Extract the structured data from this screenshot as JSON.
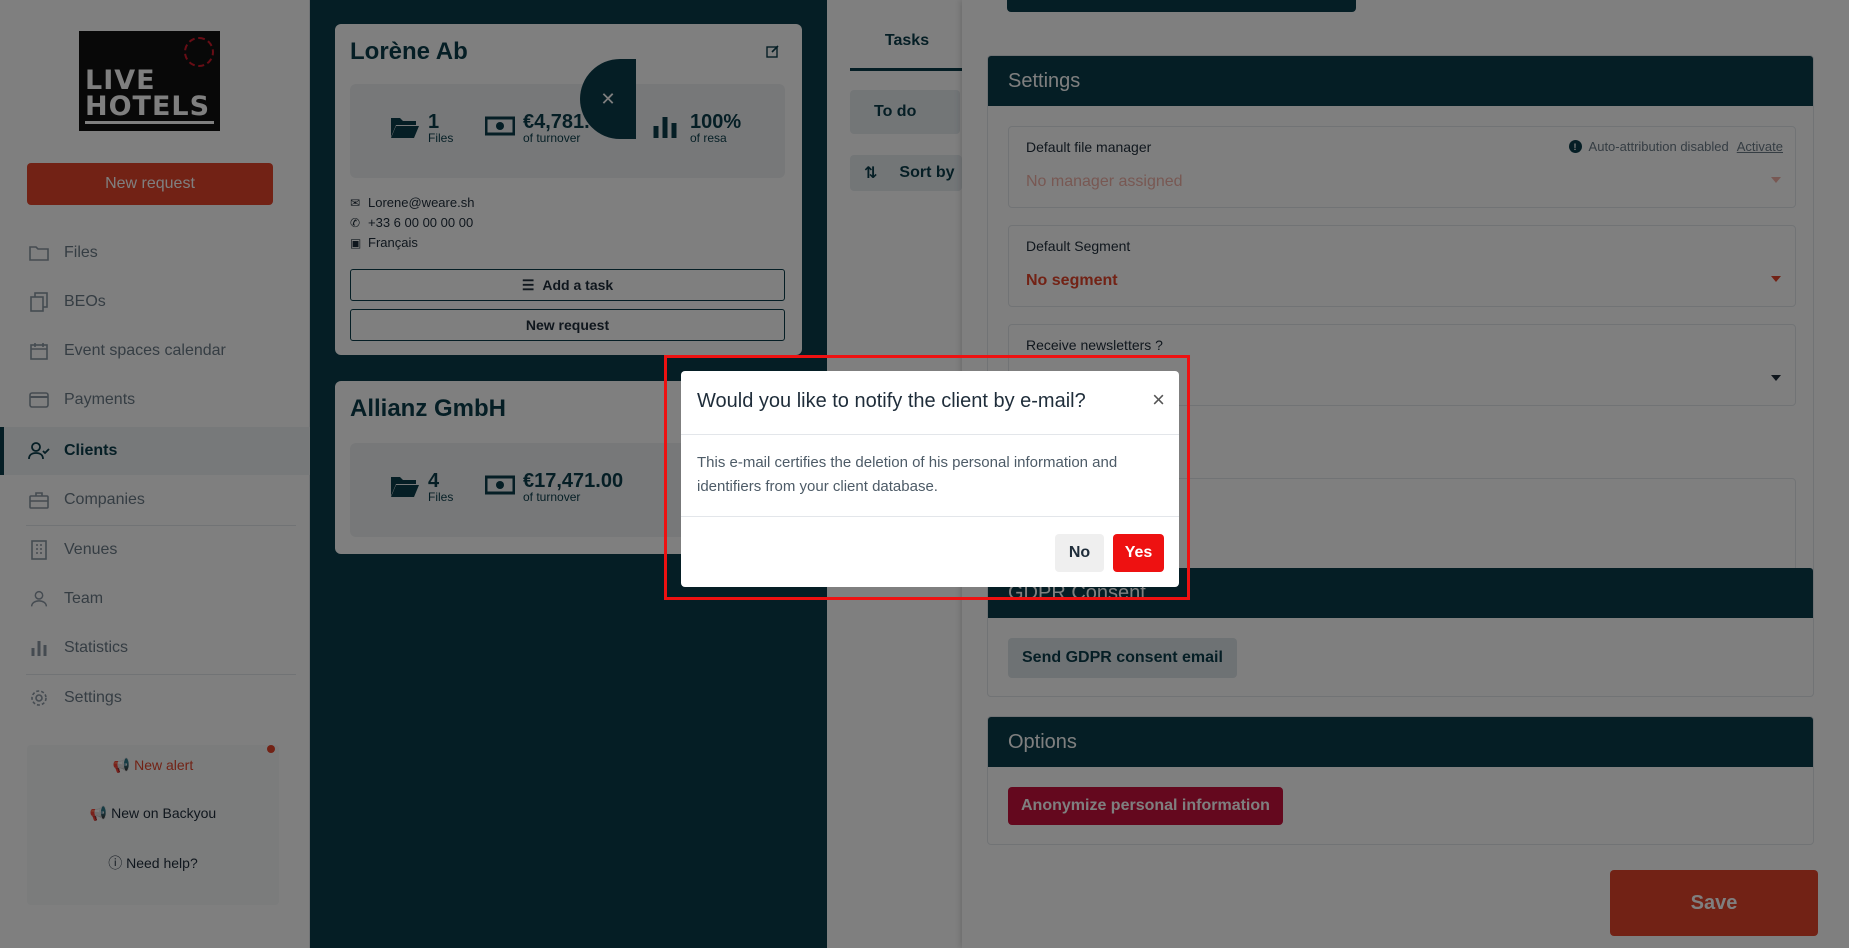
{
  "sidebar": {
    "logo_line1": "LIVE",
    "logo_line2": "HOTELS",
    "new_request_label": "New request",
    "items": [
      {
        "label": "Files",
        "icon": "folder-icon"
      },
      {
        "label": "BEOs",
        "icon": "copy-icon"
      },
      {
        "label": "Event spaces calendar",
        "icon": "calendar-icon"
      },
      {
        "label": "Payments",
        "icon": "credit-card-icon"
      },
      {
        "label": "Clients",
        "icon": "users-icon",
        "active": true
      },
      {
        "label": "Companies",
        "icon": "briefcase-icon"
      },
      {
        "label": "Venues",
        "icon": "building-icon"
      },
      {
        "label": "Team",
        "icon": "team-icon"
      },
      {
        "label": "Statistics",
        "icon": "bar-chart-icon"
      },
      {
        "label": "Settings",
        "icon": "gear-icon"
      }
    ],
    "new_alert": "New alert",
    "new_on_backyou": "New on Backyou",
    "need_help": "Need help?"
  },
  "clients": [
    {
      "name": "Lorène Ab",
      "files": "1",
      "files_label": "Files",
      "turnover": "€4,781.00",
      "turnover_label": "of turnover",
      "resa": "100%",
      "resa_label": "of resa",
      "email": "Lorene@weare.sh",
      "phone": "+33 6 00 00 00 00",
      "language": "Français",
      "add_task_label": "Add a task",
      "new_request_label": "New request"
    },
    {
      "name": "Allianz GmbH",
      "files": "4",
      "files_label": "Files",
      "turnover": "€17,471.00",
      "turnover_label": "of turnover"
    }
  ],
  "tasks": {
    "tab_label": "Tasks",
    "todo_label": "To do",
    "sort_label": "Sort by"
  },
  "drawer": {
    "settings_title": "Settings",
    "file_manager_label": "Default file manager",
    "file_manager_value": "No manager assigned",
    "auto_attr_text": "Auto-attribution disabled",
    "activate_link": "Activate",
    "segment_label": "Default Segment",
    "segment_value": "No segment",
    "newsletter_label": "Receive newsletters ?",
    "gdpr_title": "GDPR Consent",
    "gdpr_button": "Send GDPR consent email",
    "options_title": "Options",
    "anonymize_button": "Anonymize personal information",
    "save_label": "Save"
  },
  "modal": {
    "title": "Would you like to notify the client by e-mail?",
    "body": "This e-mail certifies the deletion of his personal information and identifiers from your client database.",
    "no_label": "No",
    "yes_label": "Yes"
  },
  "colors": {
    "primary_teal": "#0b3d4a",
    "accent_orange": "#e5452b",
    "danger_red": "#ee1111",
    "anonymize_crimson": "#c8103c"
  }
}
